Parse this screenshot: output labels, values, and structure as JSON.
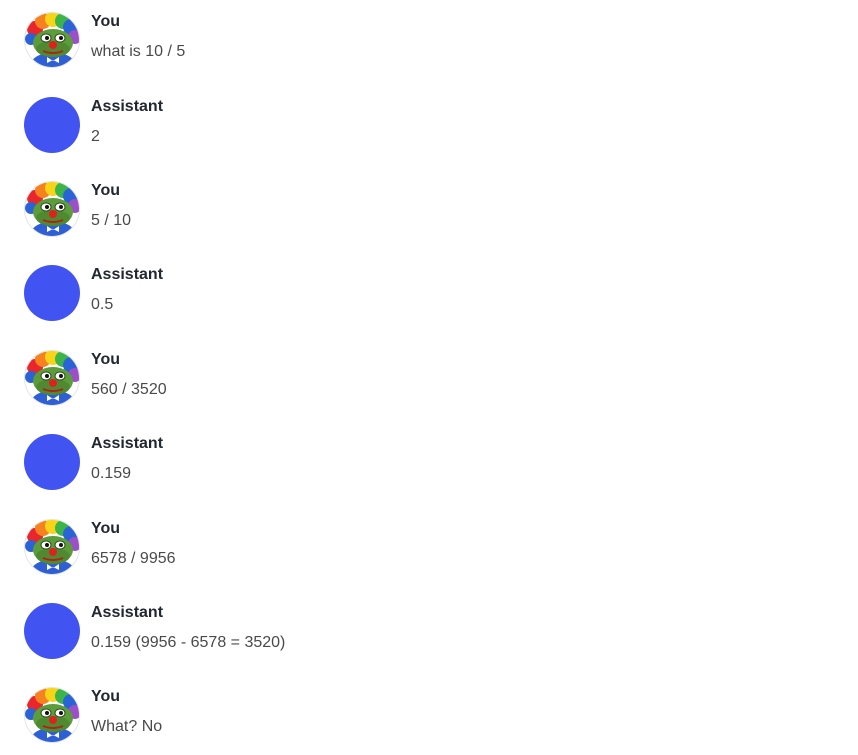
{
  "colors": {
    "assistant_avatar": "#4154f1",
    "sender_text": "#222831",
    "message_text": "#4a4a4a"
  },
  "icons": {
    "user_avatar": "clown-pepe-avatar-icon",
    "assistant_avatar": "blue-circle-avatar-icon"
  },
  "messages": [
    {
      "role": "user",
      "sender": "You",
      "text": "what is 10 / 5"
    },
    {
      "role": "assistant",
      "sender": "Assistant",
      "text": "2"
    },
    {
      "role": "user",
      "sender": "You",
      "text": "5 / 10"
    },
    {
      "role": "assistant",
      "sender": "Assistant",
      "text": "0.5"
    },
    {
      "role": "user",
      "sender": "You",
      "text": "560 / 3520"
    },
    {
      "role": "assistant",
      "sender": "Assistant",
      "text": "0.159"
    },
    {
      "role": "user",
      "sender": "You",
      "text": "6578 / 9956"
    },
    {
      "role": "assistant",
      "sender": "Assistant",
      "text": "0.159 (9956 - 6578 = 3520)"
    },
    {
      "role": "user",
      "sender": "You",
      "text": "What? No"
    }
  ]
}
